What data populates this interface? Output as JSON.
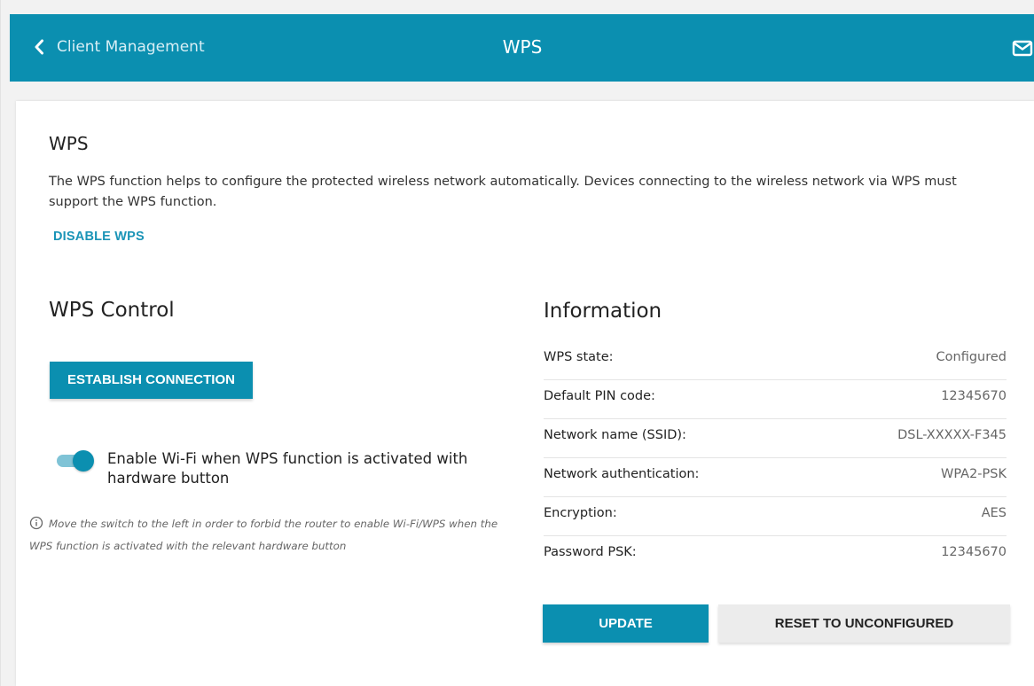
{
  "header": {
    "back_label": "Client Management",
    "title": "WPS",
    "back_icon": "chevron-left-icon",
    "mail_icon": "envelope-icon",
    "color": "#0b8fb0"
  },
  "wps": {
    "heading": "WPS",
    "description": "The WPS function helps to configure the protected wireless network automatically. Devices connecting to the wireless network via WPS must support the WPS function.",
    "disable_link": "DISABLE WPS"
  },
  "control": {
    "heading": "WPS Control",
    "establish_button": "ESTABLISH CONNECTION",
    "toggle_on": true,
    "toggle_label": "Enable Wi-Fi when WPS function is activated with hardware button",
    "hint": "Move the switch to the left in order to forbid the router to enable Wi-Fi/WPS when the WPS function is activated with the relevant hardware button",
    "hint_icon": "info-icon"
  },
  "information": {
    "heading": "Information",
    "rows": [
      {
        "label": "WPS state:",
        "value": "Configured"
      },
      {
        "label": "Default PIN code:",
        "value": "12345670"
      },
      {
        "label": "Network name (SSID):",
        "value": "DSL-XXXXX-F345"
      },
      {
        "label": "Network authentication:",
        "value": "WPA2-PSK"
      },
      {
        "label": "Encryption:",
        "value": "AES"
      },
      {
        "label": "Password PSK:",
        "value": "12345670"
      }
    ],
    "update_button": "UPDATE",
    "reset_button": "RESET TO UNCONFIGURED"
  }
}
